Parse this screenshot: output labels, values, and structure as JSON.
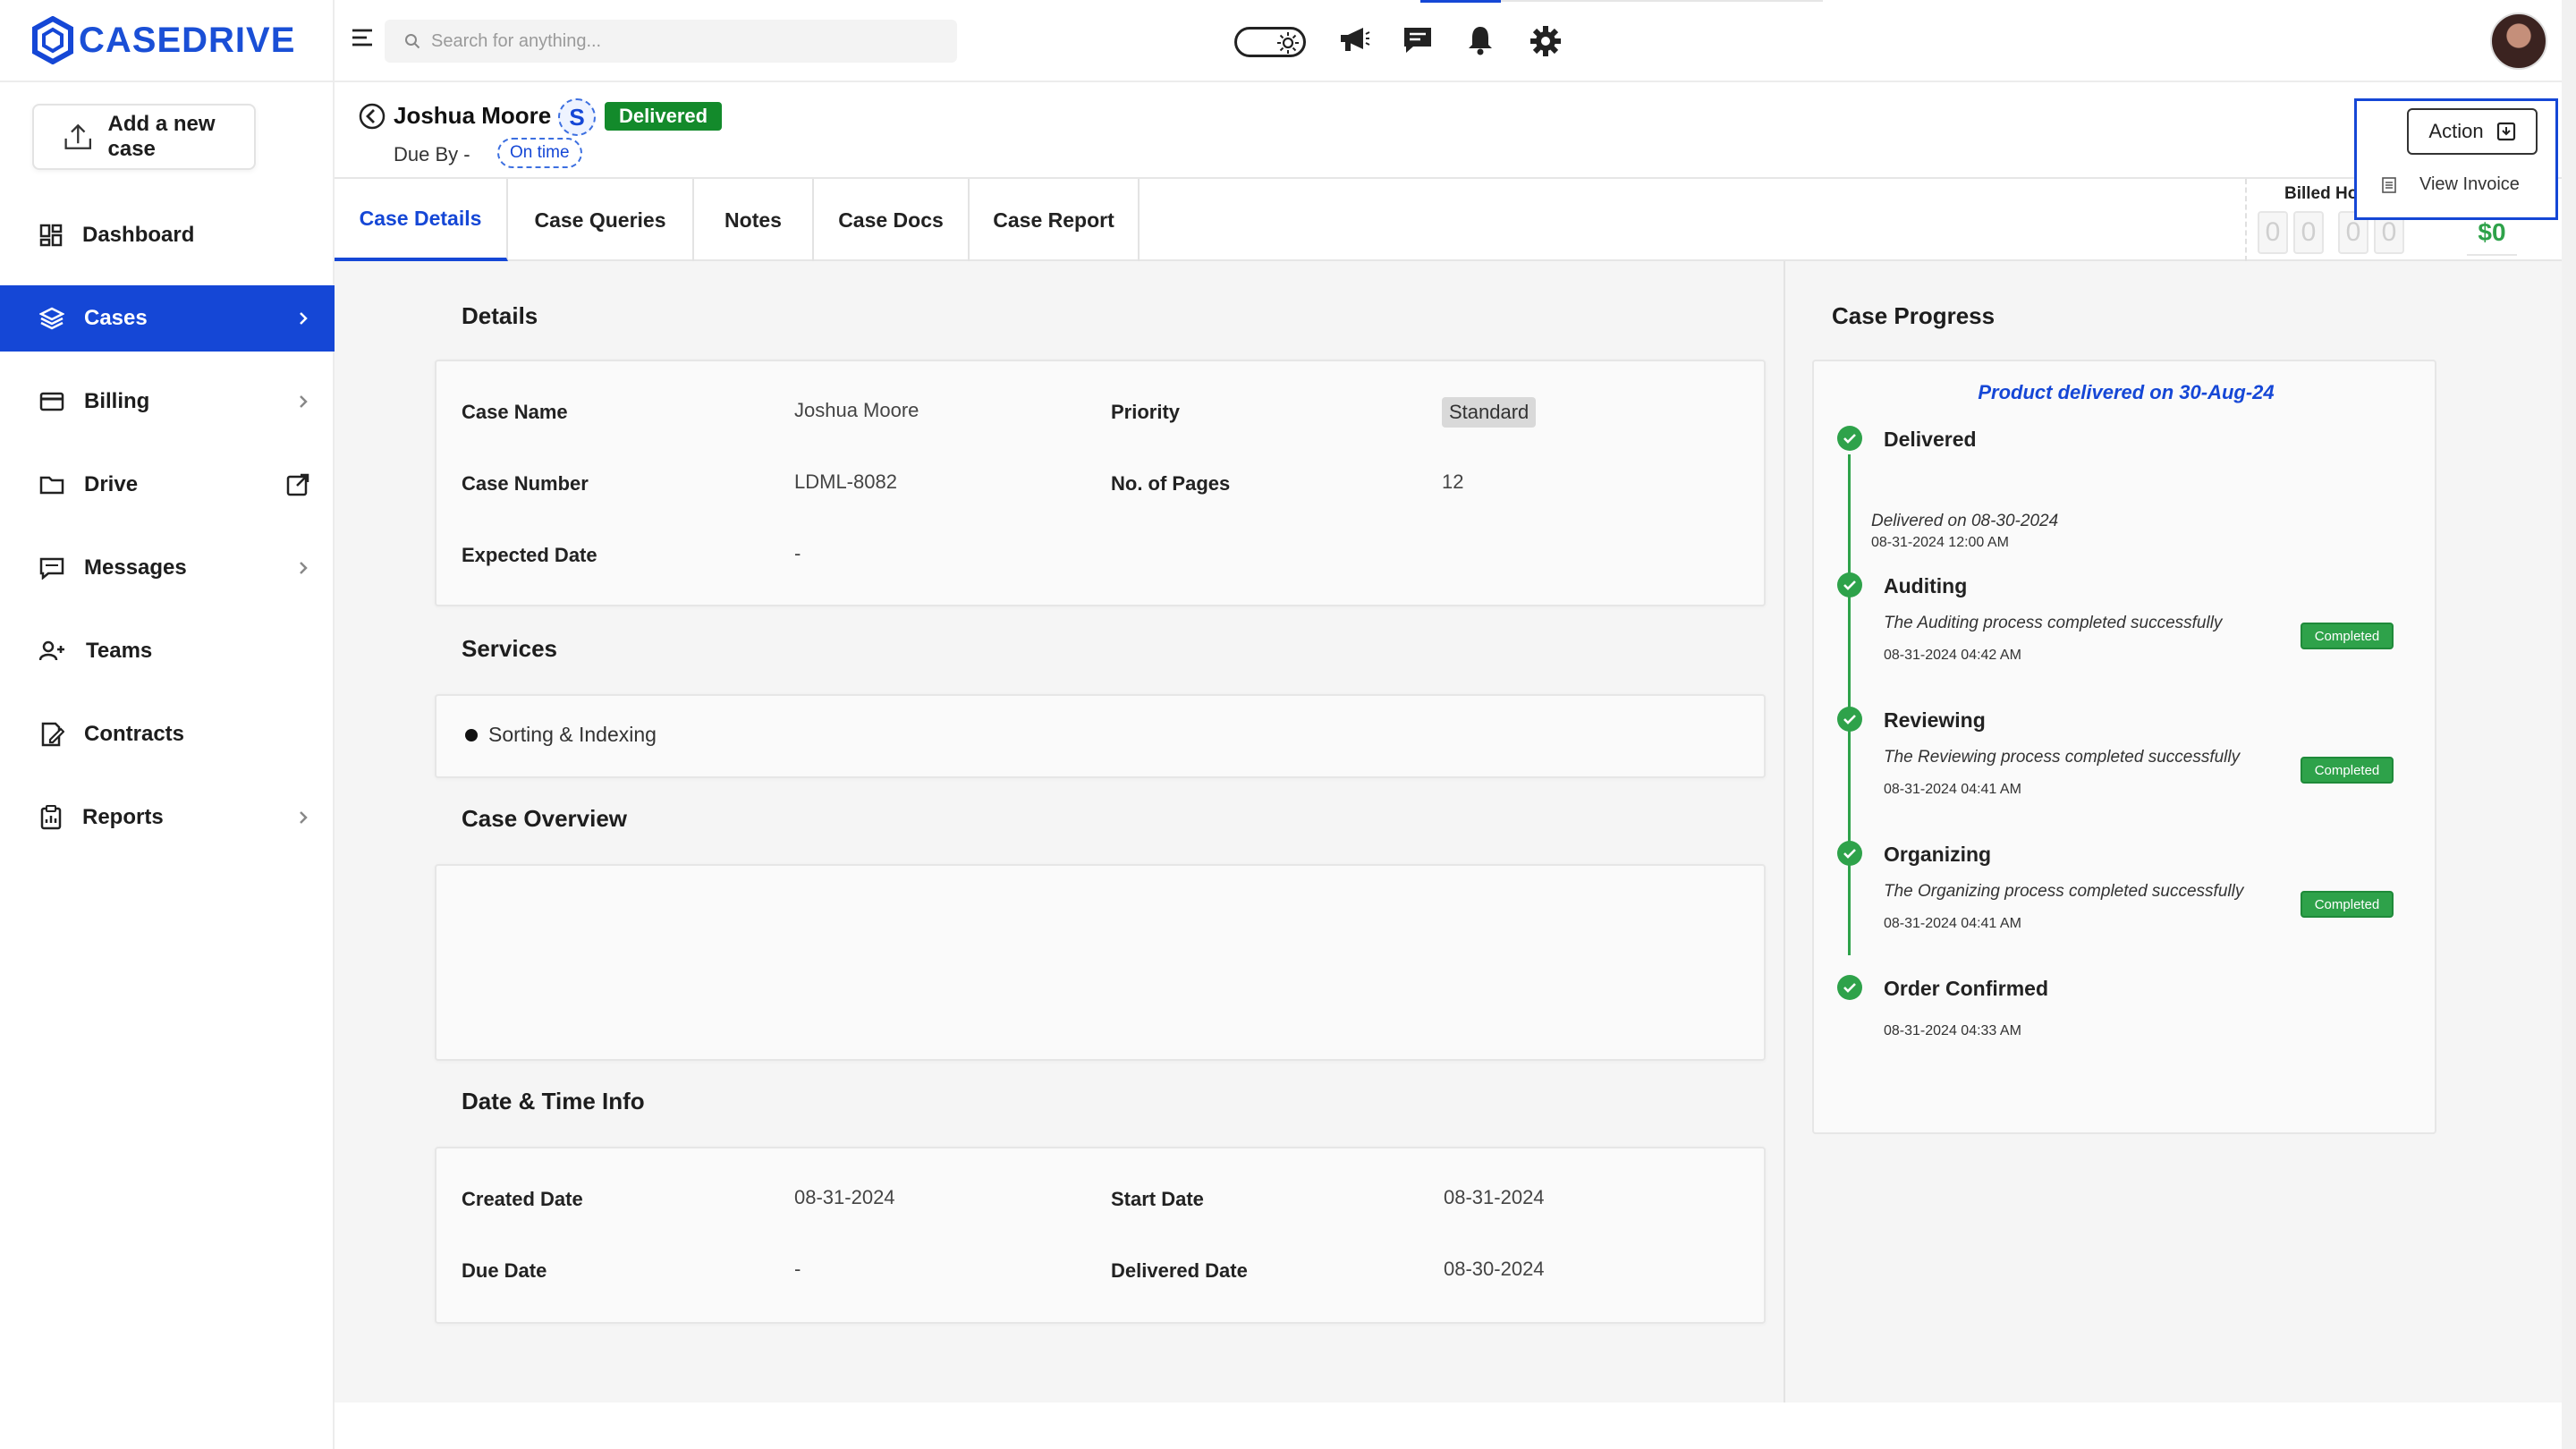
{
  "brand": {
    "name": "CASEDRIVE",
    "color": "#1547d6"
  },
  "sidebar": {
    "add_case_label": "Add a new case",
    "items": [
      {
        "label": "Dashboard",
        "icon": "dashboard-icon",
        "active": false,
        "chevron": false
      },
      {
        "label": "Cases",
        "icon": "layers-icon",
        "active": true,
        "chevron": true
      },
      {
        "label": "Billing",
        "icon": "card-icon",
        "active": false,
        "chevron": true
      },
      {
        "label": "Drive",
        "icon": "folder-icon",
        "active": false,
        "chevron": false,
        "external": true
      },
      {
        "label": "Messages",
        "icon": "message-icon",
        "active": false,
        "chevron": true
      },
      {
        "label": "Teams",
        "icon": "team-icon",
        "active": false,
        "chevron": false
      },
      {
        "label": "Contracts",
        "icon": "contract-icon",
        "active": false,
        "chevron": false
      },
      {
        "label": "Reports",
        "icon": "report-icon",
        "active": false,
        "chevron": true
      }
    ]
  },
  "topbar": {
    "search_placeholder": "Search for anything...",
    "icons": [
      "menu-icon",
      "theme-toggle",
      "megaphone-icon",
      "chat-icon",
      "bell-icon",
      "gear-icon",
      "avatar"
    ]
  },
  "case": {
    "name": "Joshua Moore",
    "service_initial": "S",
    "status": "Delivered",
    "due_by_label": "Due By -",
    "due_status": "On time"
  },
  "action_menu": {
    "button_label": "Action",
    "items": [
      "View Invoice"
    ]
  },
  "tabs": [
    "Case Details",
    "Case Queries",
    "Notes",
    "Case Docs",
    "Case Report"
  ],
  "billed": {
    "label": "Billed Ho",
    "digits": [
      "0",
      "0",
      "0",
      "0"
    ],
    "amount": "$0"
  },
  "details": {
    "title": "Details",
    "case_name_label": "Case Name",
    "case_name_value": "Joshua  Moore",
    "priority_label": "Priority",
    "priority_value": "Standard",
    "case_number_label": "Case Number",
    "case_number_value": "LDML-8082",
    "pages_label": "No. of Pages",
    "pages_value": "12",
    "expected_label": "Expected Date",
    "expected_value": "-"
  },
  "services": {
    "title": "Services",
    "items": [
      "Sorting & Indexing"
    ]
  },
  "overview": {
    "title": "Case Overview"
  },
  "datetime": {
    "title": "Date & Time Info",
    "created_label": "Created Date",
    "created_value": "08-31-2024",
    "start_label": "Start Date",
    "start_value": "08-31-2024",
    "due_label": "Due Date",
    "due_value": "-",
    "delivered_label": "Delivered Date",
    "delivered_value": "08-30-2024"
  },
  "progress": {
    "title": "Case Progress",
    "banner": "Product delivered on 30-Aug-24",
    "steps": [
      {
        "name": "Delivered",
        "desc": "Delivered on 08-30-2024",
        "time": "08-31-2024 12:00 AM",
        "badge": ""
      },
      {
        "name": "Auditing",
        "desc": "The Auditing process completed successfully",
        "time": "08-31-2024 04:42 AM",
        "badge": "Completed"
      },
      {
        "name": "Reviewing",
        "desc": "The Reviewing process completed successfully",
        "time": "08-31-2024 04:41 AM",
        "badge": "Completed"
      },
      {
        "name": "Organizing",
        "desc": "The Organizing process completed successfully",
        "time": "08-31-2024 04:41 AM",
        "badge": "Completed"
      },
      {
        "name": "Order Confirmed",
        "desc": "",
        "time": "08-31-2024 04:33 AM",
        "badge": ""
      }
    ]
  }
}
